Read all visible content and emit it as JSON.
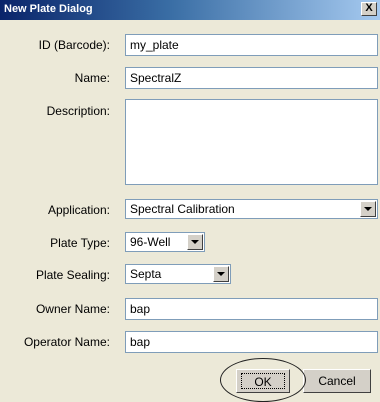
{
  "window": {
    "title": "New Plate Dialog",
    "close_label": "X"
  },
  "fields": {
    "id": {
      "label": "ID (Barcode):",
      "value": "my_plate"
    },
    "name": {
      "label": "Name:",
      "value": "SpectralZ"
    },
    "description": {
      "label": "Description:",
      "value": ""
    },
    "application": {
      "label": "Application:",
      "value": "Spectral Calibration"
    },
    "plate_type": {
      "label": "Plate Type:",
      "value": "96-Well"
    },
    "plate_sealing": {
      "label": "Plate Sealing:",
      "value": "Septa"
    },
    "owner": {
      "label": "Owner Name:",
      "value": "bap"
    },
    "operator": {
      "label": "Operator Name:",
      "value": "bap"
    }
  },
  "buttons": {
    "ok": "OK",
    "cancel": "Cancel"
  },
  "colors": {
    "dialog_bg": "#ece9d8",
    "titlebar": "#0a246a",
    "field_border": "#7f9db9"
  }
}
